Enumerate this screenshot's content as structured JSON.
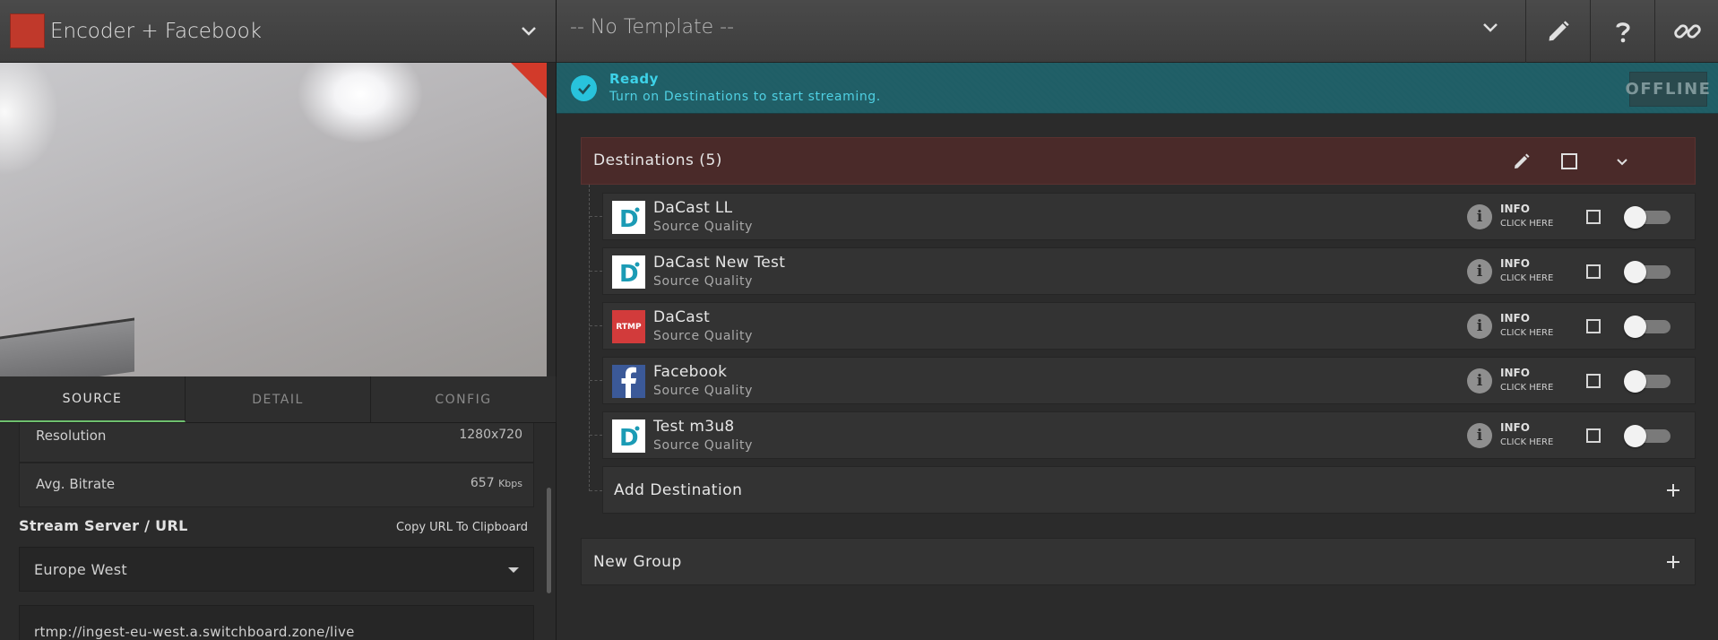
{
  "encoder": {
    "title": "Encoder + Facebook",
    "swatch_color": "#c0392b"
  },
  "tabs": [
    {
      "label": "SOURCE",
      "active": true
    },
    {
      "label": "DETAIL",
      "active": false
    },
    {
      "label": "CONFIG",
      "active": false
    }
  ],
  "source": {
    "resolution_label": "Resolution",
    "resolution_value": "1280x720",
    "bitrate_label": "Avg. Bitrate",
    "bitrate_value": "657",
    "bitrate_unit": "Kbps",
    "stream_server_label": "Stream Server / URL",
    "copy_button": "Copy URL To Clipboard",
    "region_selected": "Europe West",
    "url": "rtmp://ingest-eu-west.a.switchboard.zone/live"
  },
  "topbar": {
    "template_selected": "-- No Template --",
    "edit_icon": "pencil-icon",
    "help_icon": "question-icon",
    "link_icon": "link-icon"
  },
  "status": {
    "title": "Ready",
    "message": "Turn on Destinations to start streaming.",
    "badge": "OFFLINE",
    "color": "#28c3dc"
  },
  "destinations_group": {
    "title": "Destinations (5)",
    "items": [
      {
        "name": "DaCast LL",
        "quality": "Source Quality",
        "logo": "dacast-logo",
        "info": "INFO",
        "info_sub": "CLICK HERE"
      },
      {
        "name": "DaCast New Test",
        "quality": "Source Quality",
        "logo": "dacast-logo",
        "info": "INFO",
        "info_sub": "CLICK HERE"
      },
      {
        "name": "DaCast",
        "quality": "Source Quality",
        "logo": "rtmp-logo",
        "logo_text": "RTMP",
        "info": "INFO",
        "info_sub": "CLICK HERE"
      },
      {
        "name": "Facebook",
        "quality": "Source Quality",
        "logo": "facebook-logo",
        "info": "INFO",
        "info_sub": "CLICK HERE"
      },
      {
        "name": "Test m3u8",
        "quality": "Source Quality",
        "logo": "dacast-logo",
        "info": "INFO",
        "info_sub": "CLICK HERE"
      }
    ],
    "add_label": "Add Destination"
  },
  "new_group_label": "New Group"
}
